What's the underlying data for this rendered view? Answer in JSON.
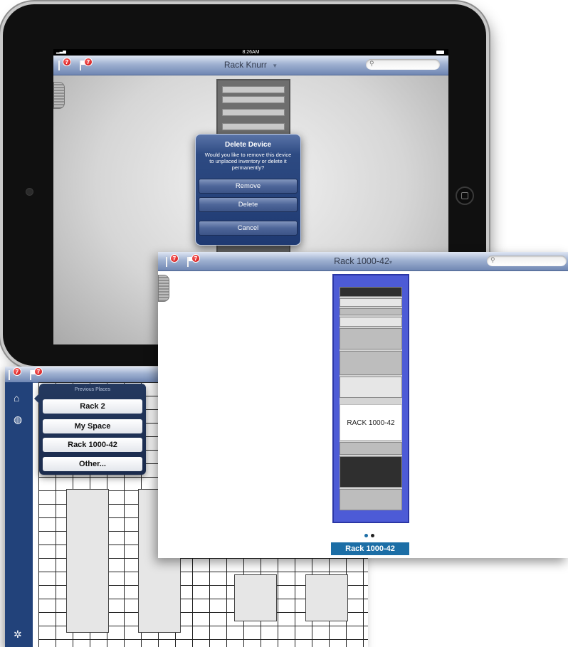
{
  "ipad": {
    "status": {
      "time": "8:26AM"
    },
    "nav": {
      "title": "Rack Knurr",
      "caret": "▼",
      "badge_count": "7"
    },
    "alert": {
      "title": "Delete Device",
      "message": "Would you like to remove this device to unplaced inventory or delete it permanently?",
      "buttons": [
        "Remove",
        "Delete",
        "Cancel"
      ]
    }
  },
  "rack_window": {
    "nav": {
      "title": "Rack 1000-42",
      "caret": "▾",
      "badge_count": "7"
    },
    "rack_label": "RACK 1000-42",
    "caption": "Rack 1000-42",
    "page_dots": 2,
    "active_dot": 0
  },
  "floor_window": {
    "nav": {
      "badge_count": "7"
    },
    "popover": {
      "title": "Previous Places",
      "items": [
        "Rack 2",
        "My Space",
        "Rack 1000-42",
        "Other..."
      ]
    },
    "rail_icons": [
      "home-icon",
      "globe-icon",
      "gear-icon"
    ]
  },
  "colors": {
    "nav_blue": "#6f86b3",
    "alert_blue": "#1f3a72",
    "rack_blue": "#4d5bd6",
    "caption_blue": "#1c6ea6",
    "rail_blue": "#22427a",
    "badge_red": "#c40000"
  }
}
